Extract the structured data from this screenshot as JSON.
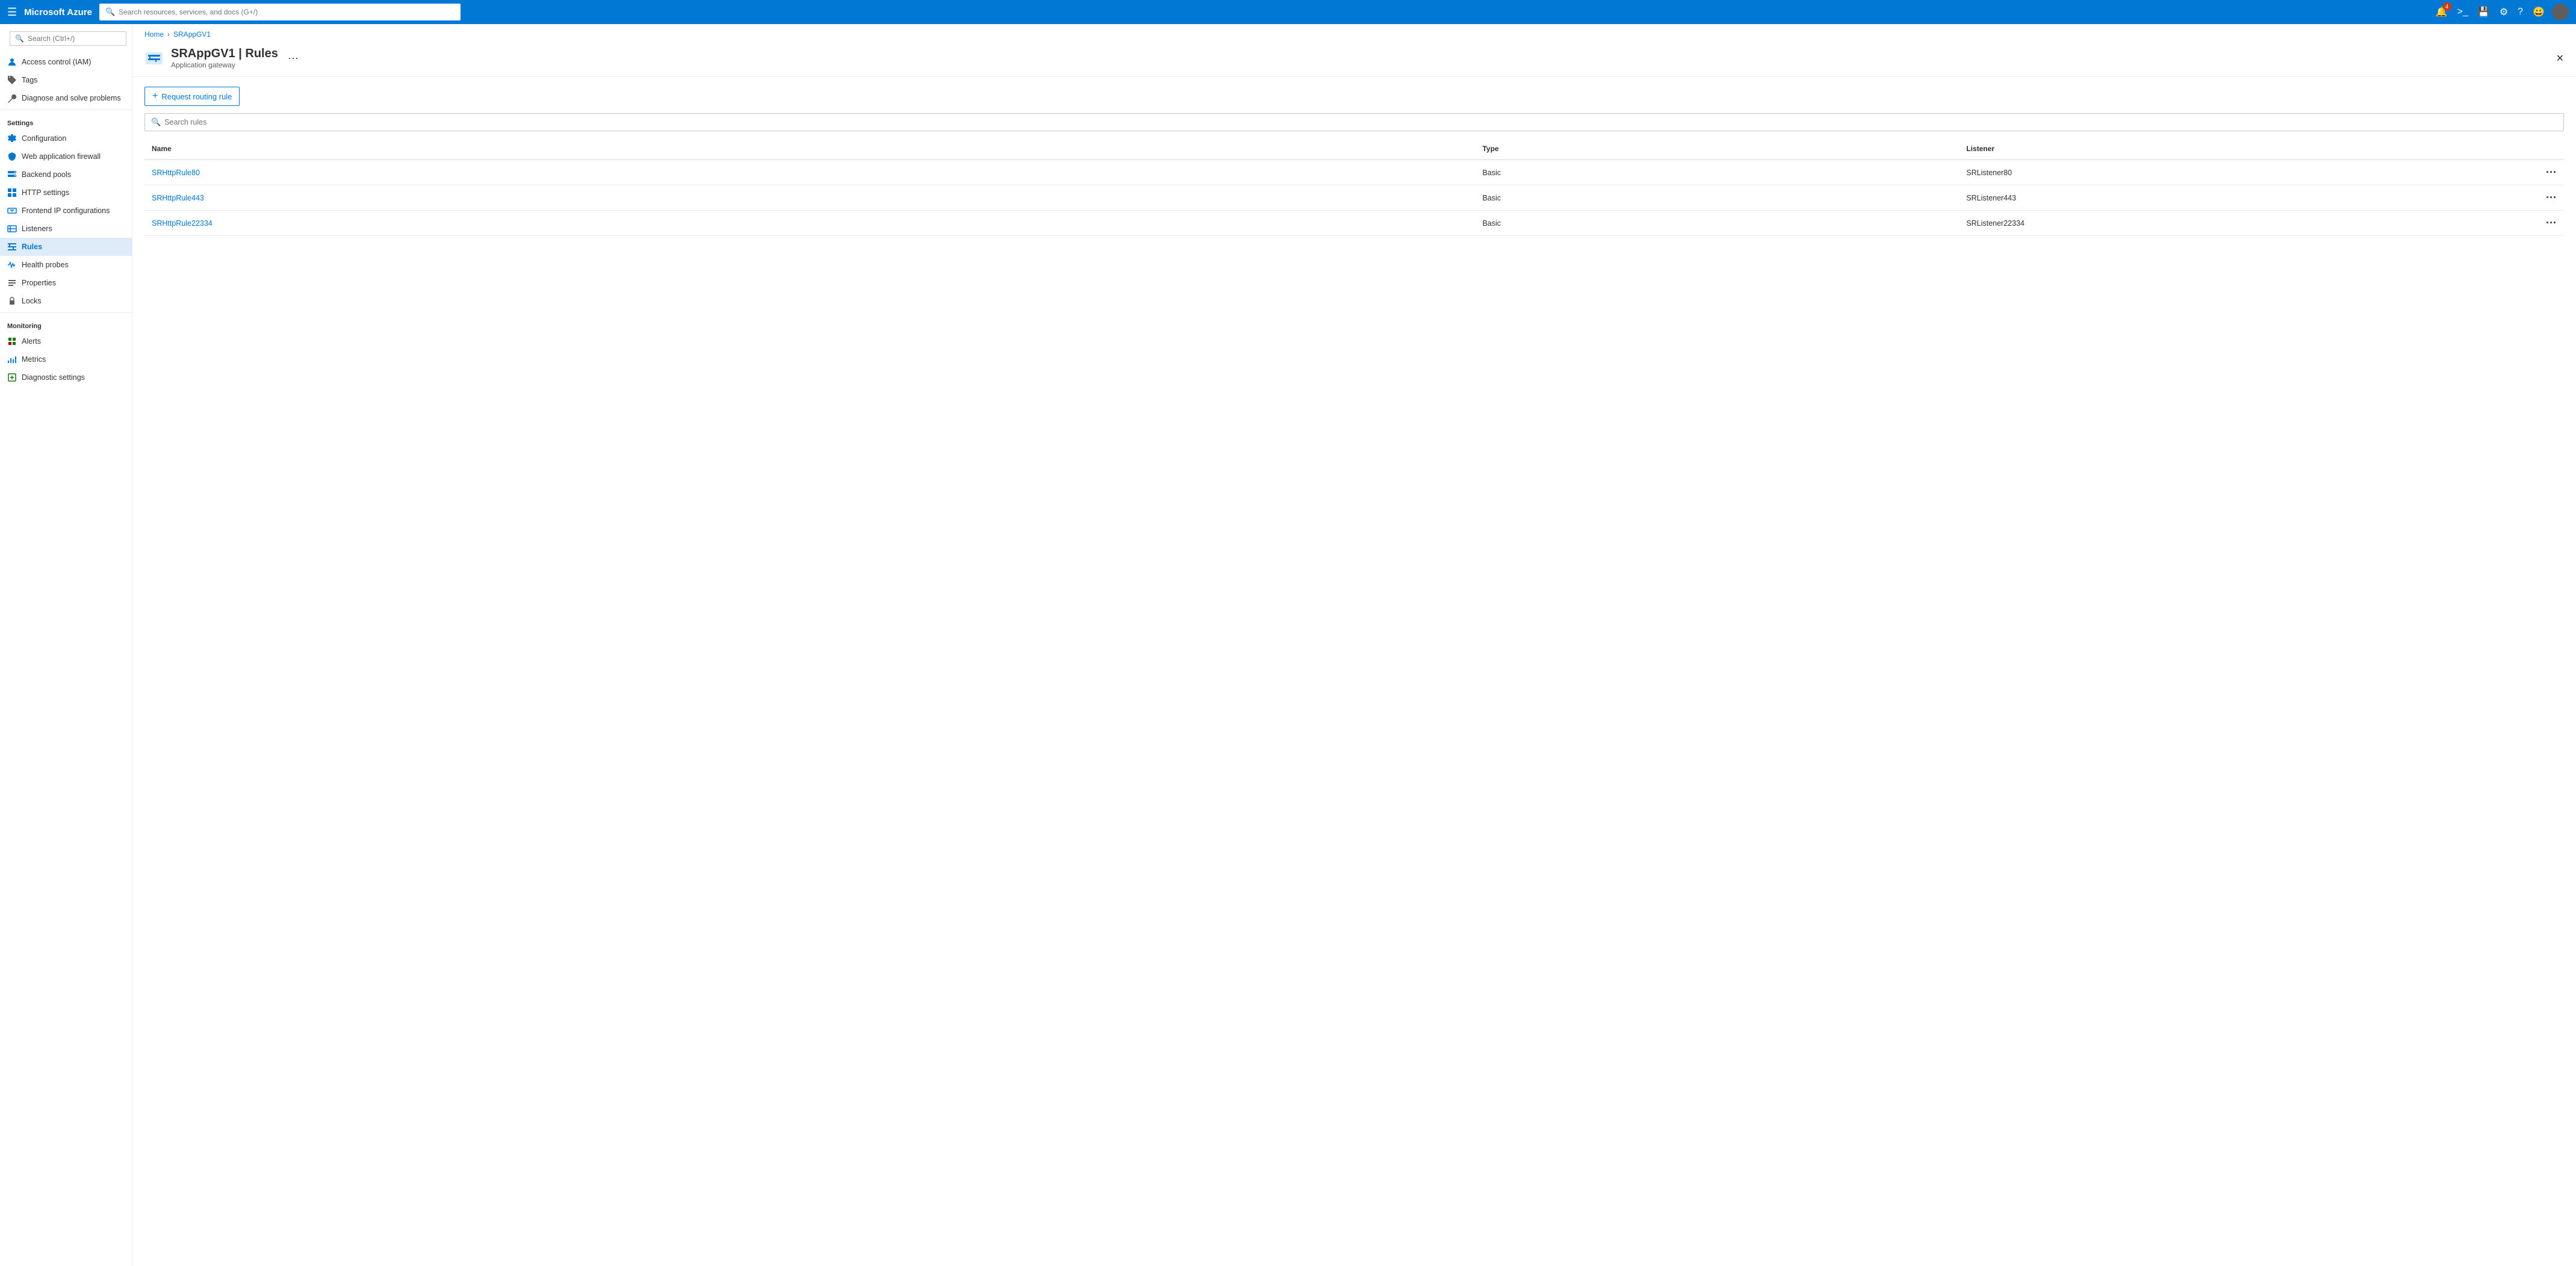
{
  "topbar": {
    "logo": "Microsoft Azure",
    "search_placeholder": "Search resources, services, and docs (G+/)",
    "notification_count": "4"
  },
  "breadcrumb": {
    "home": "Home",
    "resource": "SRAppGV1"
  },
  "page_header": {
    "title": "SRAppGV1 | Rules",
    "subtitle": "Application gateway",
    "more_label": "···"
  },
  "sidebar": {
    "search_placeholder": "Search (Ctrl+/)",
    "items_top": [
      {
        "id": "access-control",
        "label": "Access control (IAM)",
        "icon": "person-icon"
      },
      {
        "id": "tags",
        "label": "Tags",
        "icon": "tag-icon"
      },
      {
        "id": "diagnose",
        "label": "Diagnose and solve problems",
        "icon": "wrench-icon"
      }
    ],
    "settings_label": "Settings",
    "settings_items": [
      {
        "id": "configuration",
        "label": "Configuration",
        "icon": "gear-icon"
      },
      {
        "id": "waf",
        "label": "Web application firewall",
        "icon": "shield-icon"
      },
      {
        "id": "backend-pools",
        "label": "Backend pools",
        "icon": "server-icon"
      },
      {
        "id": "http-settings",
        "label": "HTTP settings",
        "icon": "grid-icon"
      },
      {
        "id": "frontend-ip",
        "label": "Frontend IP configurations",
        "icon": "ip-icon"
      },
      {
        "id": "listeners",
        "label": "Listeners",
        "icon": "listeners-icon"
      },
      {
        "id": "rules",
        "label": "Rules",
        "icon": "rules-icon",
        "active": true
      },
      {
        "id": "health-probes",
        "label": "Health probes",
        "icon": "probe-icon"
      },
      {
        "id": "properties",
        "label": "Properties",
        "icon": "properties-icon"
      },
      {
        "id": "locks",
        "label": "Locks",
        "icon": "lock-icon"
      }
    ],
    "monitoring_label": "Monitoring",
    "monitoring_items": [
      {
        "id": "alerts",
        "label": "Alerts",
        "icon": "alert-icon"
      },
      {
        "id": "metrics",
        "label": "Metrics",
        "icon": "metrics-icon"
      },
      {
        "id": "diagnostic-settings",
        "label": "Diagnostic settings",
        "icon": "diagnostic-icon"
      }
    ]
  },
  "content": {
    "add_button_label": "Request routing rule",
    "search_placeholder": "Search rules",
    "table": {
      "columns": [
        "Name",
        "Type",
        "Listener"
      ],
      "rows": [
        {
          "name": "SRHttpRule80",
          "type": "Basic",
          "listener": "SRListener80"
        },
        {
          "name": "SRHttpRule443",
          "type": "Basic",
          "listener": "SRListener443"
        },
        {
          "name": "SRHttpRule22334",
          "type": "Basic",
          "listener": "SRListener22334"
        }
      ]
    }
  }
}
